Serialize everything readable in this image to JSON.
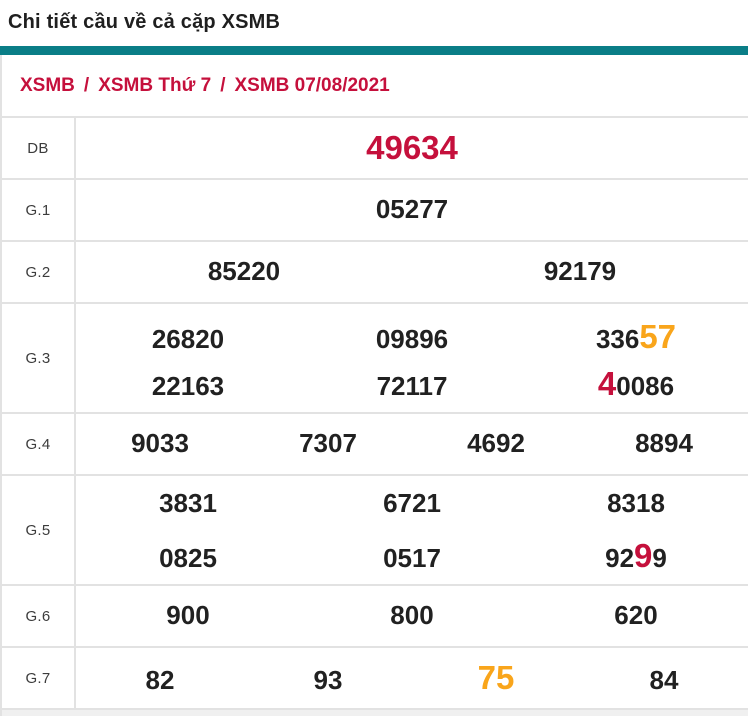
{
  "page_title": "Chi tiết cầu về cả cặp XSMB",
  "breadcrumb": {
    "separator": "/",
    "items": [
      "XSMB",
      "XSMB Thứ 7",
      "XSMB 07/08/2021"
    ]
  },
  "colors": {
    "accent_teal": "#0a7e87",
    "crimson": "#c5103c",
    "orange": "#f9a51b",
    "digit": "#212121",
    "label": "#3c3c3c",
    "border": "#e2e2e2"
  },
  "table": {
    "rows": [
      {
        "label": "DB",
        "lines": [
          [
            [
              {
                "t": "49634",
                "c": "red",
                "big": true
              }
            ]
          ]
        ]
      },
      {
        "label": "G.1",
        "lines": [
          [
            [
              {
                "t": "05277"
              }
            ]
          ]
        ]
      },
      {
        "label": "G.2",
        "lines": [
          [
            [
              {
                "t": "85220"
              }
            ],
            [
              {
                "t": "92179"
              }
            ]
          ]
        ]
      },
      {
        "label": "G.3",
        "lines": [
          [
            [
              {
                "t": "26820"
              }
            ],
            [
              {
                "t": "09896"
              }
            ],
            [
              {
                "t": "336"
              },
              {
                "t": "57",
                "c": "orange",
                "big": true
              }
            ]
          ],
          [
            [
              {
                "t": "22163"
              }
            ],
            [
              {
                "t": "72117"
              }
            ],
            [
              {
                "t": "4",
                "c": "red",
                "big": true
              },
              {
                "t": "0086"
              }
            ]
          ]
        ]
      },
      {
        "label": "G.4",
        "lines": [
          [
            [
              {
                "t": "9033"
              }
            ],
            [
              {
                "t": "7307"
              }
            ],
            [
              {
                "t": "4692"
              }
            ],
            [
              {
                "t": "8894"
              }
            ]
          ]
        ]
      },
      {
        "label": "G.5",
        "lines": [
          [
            [
              {
                "t": "3831"
              }
            ],
            [
              {
                "t": "6721"
              }
            ],
            [
              {
                "t": "8318"
              }
            ]
          ],
          [
            [
              {
                "t": "0825"
              }
            ],
            [
              {
                "t": "0517"
              }
            ],
            [
              {
                "t": "92"
              },
              {
                "t": "9",
                "c": "red",
                "big": true
              },
              {
                "t": "9"
              }
            ]
          ]
        ]
      },
      {
        "label": "G.6",
        "lines": [
          [
            [
              {
                "t": "900"
              }
            ],
            [
              {
                "t": "800"
              }
            ],
            [
              {
                "t": "620"
              }
            ]
          ]
        ]
      },
      {
        "label": "G.7",
        "lines": [
          [
            [
              {
                "t": "82"
              }
            ],
            [
              {
                "t": "93"
              }
            ],
            [
              {
                "t": "75",
                "c": "orange",
                "big": true
              }
            ],
            [
              {
                "t": "84"
              }
            ]
          ]
        ]
      }
    ]
  }
}
